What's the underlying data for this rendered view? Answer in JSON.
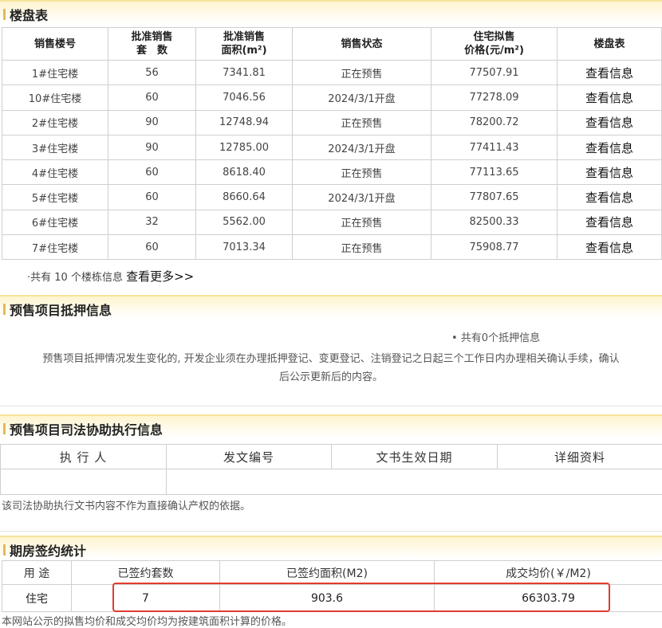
{
  "building_section": {
    "title": "楼盘表",
    "headers": [
      "销售楼号",
      "批准销售\n套　数",
      "批准销售\n面积(m²)",
      "销售状态",
      "住宅拟售\n价格(元/m²)",
      "楼盘表"
    ],
    "rows": [
      [
        "1#住宅楼",
        "56",
        "7341.81",
        "正在预售",
        "77507.91",
        "查看信息"
      ],
      [
        "10#住宅楼",
        "60",
        "7046.56",
        "2024/3/1开盘",
        "77278.09",
        "查看信息"
      ],
      [
        "2#住宅楼",
        "90",
        "12748.94",
        "正在预售",
        "78200.72",
        "查看信息"
      ],
      [
        "3#住宅楼",
        "90",
        "12785.00",
        "2024/3/1开盘",
        "77411.43",
        "查看信息"
      ],
      [
        "4#住宅楼",
        "60",
        "8618.40",
        "正在预售",
        "77113.65",
        "查看信息"
      ],
      [
        "5#住宅楼",
        "60",
        "8660.64",
        "2024/3/1开盘",
        "77807.65",
        "查看信息"
      ],
      [
        "6#住宅楼",
        "32",
        "5562.00",
        "正在预售",
        "82500.33",
        "查看信息"
      ],
      [
        "7#住宅楼",
        "60",
        "7013.34",
        "正在预售",
        "75908.77",
        "查看信息"
      ]
    ],
    "total_text": "·共有 10 个楼栋信息",
    "more_link": "查看更多>>"
  },
  "mortgage_section": {
    "title": "预售项目抵押信息",
    "count_text": "• 共有0个抵押信息",
    "notice_line1": "预售项目抵押情况发生变化的, 开发企业须在办理抵押登记、变更登记、注销登记之日起三个工作日内办理相关确认手续，确认",
    "notice_line2": "后公示更新后的内容。"
  },
  "judicial_section": {
    "title": "预售项目司法协助执行信息",
    "headers": [
      "执 行 人",
      "发文编号",
      "文书生效日期",
      "详细资料"
    ],
    "note": "该司法协助执行文书内容不作为直接确认产权的依据。"
  },
  "contract_section": {
    "title": "期房签约统计",
    "headers": [
      "用 途",
      "已签约套数",
      "已签约面积(M2)",
      "成交均价(￥/M2)"
    ],
    "row": [
      "住宅",
      "7",
      "903.6",
      "66303.79"
    ],
    "footnote": "本网站公示的拟售均价和成交均价均为按建筑面积计算的价格。",
    "highlight_color": "#e23b2e"
  }
}
